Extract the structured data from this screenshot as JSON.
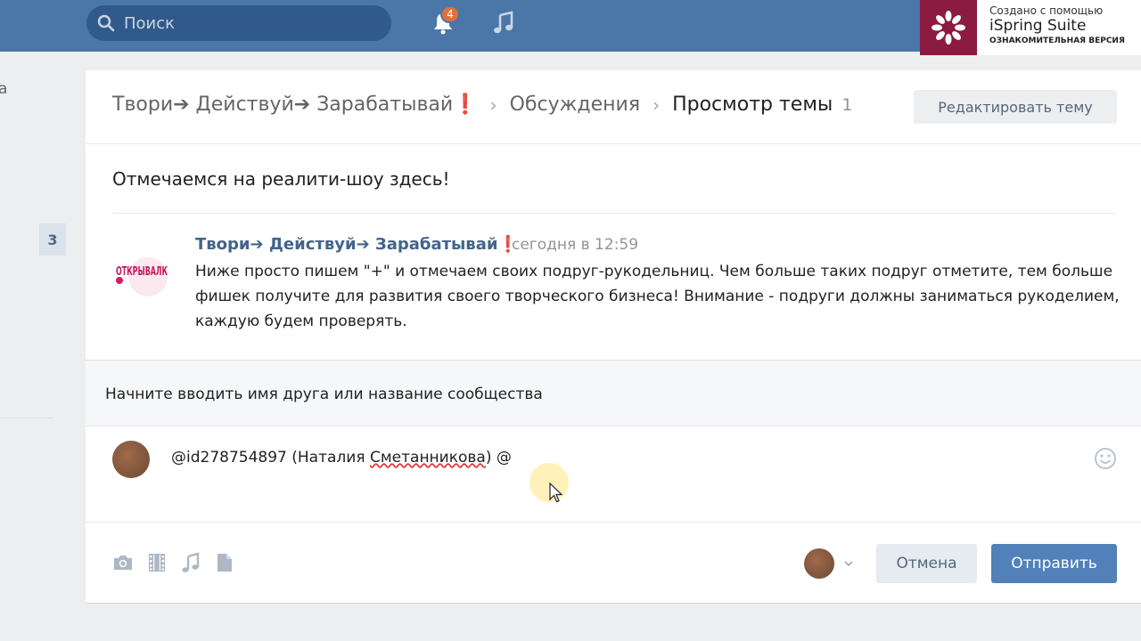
{
  "topbar": {
    "search_placeholder": "Поиск",
    "notifications_count": "4"
  },
  "watermark": {
    "line1": "Создано с помощью",
    "line2": "iSpring Suite",
    "line3": "ОЗНАКОМИТЕЛЬНАЯ ВЕРСИЯ"
  },
  "left": {
    "partial_text": "а",
    "counter": "3"
  },
  "breadcrumb": {
    "group": "Твори➔ Действуй➔ Зарабатывай❗",
    "discussions": "Обсуждения",
    "current": "Просмотр темы",
    "count": "1"
  },
  "edit_button": "Редактировать тему",
  "topic_title": "Отмечаемся на реалити-шоу здесь!",
  "post": {
    "author": "Твори➔ Действуй➔ Зарабатывай❗",
    "time": "сегодня в 12:59",
    "text": "Ниже просто пишем \"+\" и отмечаем своих подруг-рукодельниц. Чем больше таких подруг отметите, тем больше фишек получите для развития своего творческого бизнеса! Внимание - подруги должны заниматься рукоделием, каждую будем проверять.",
    "avatar_text": "ОТКРЫВАЛК"
  },
  "mention_hint": "Начните вводить имя друга или название сообщества",
  "comment": {
    "prefix": "@id278754897 (Наталия ",
    "misspelled": "Сметанникова",
    "suffix": ") @"
  },
  "buttons": {
    "cancel": "Отмена",
    "send": "Отправить"
  },
  "colors": {
    "header": "#4a76a8",
    "link": "#42648b",
    "primary_button": "#5181b8",
    "watermark_brand": "#8b1b40"
  }
}
